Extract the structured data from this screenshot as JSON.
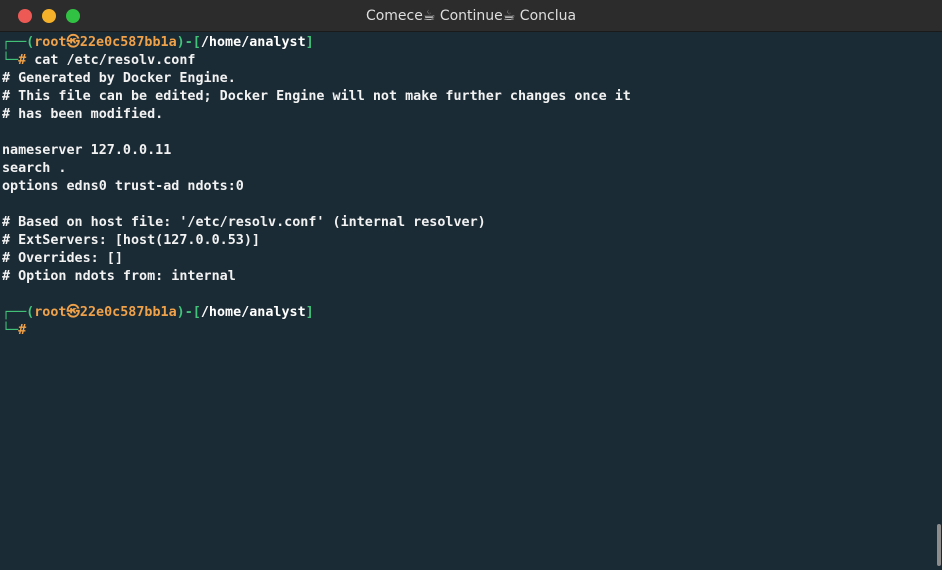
{
  "window": {
    "title": "Comece☕ Continue☕ Conclua"
  },
  "prompt": {
    "top_prefix": "┌──(",
    "user": "root",
    "at_symbol": "㉿",
    "host": "22e0c587bb1a",
    "middle": ")-[",
    "path": "/home/analyst",
    "top_suffix": "]",
    "bottom_prefix": "└─",
    "hash": "#"
  },
  "command": " cat /etc/resolv.conf",
  "output": [
    "# Generated by Docker Engine.",
    "# This file can be edited; Docker Engine will not make further changes once it",
    "# has been modified.",
    "",
    "nameserver 127.0.0.11",
    "search .",
    "options edns0 trust-ad ndots:0",
    "",
    "# Based on host file: '/etc/resolv.conf' (internal resolver)",
    "# ExtServers: [host(127.0.0.53)]",
    "# Overrides: []",
    "# Option ndots from: internal",
    ""
  ]
}
